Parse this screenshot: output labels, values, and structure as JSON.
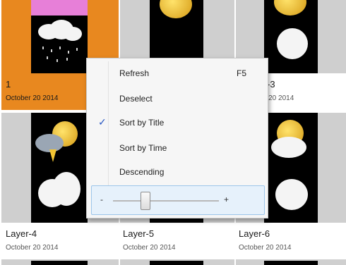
{
  "tiles": [
    {
      "title": "1",
      "date": "October 20 2014",
      "selected": true
    },
    {
      "title": "",
      "date": "",
      "selected": false
    },
    {
      "title": "-3",
      "date": "r 20 2014",
      "selected": false
    },
    {
      "title": "Layer-4",
      "date": "October 20 2014",
      "selected": false
    },
    {
      "title": "Layer-5",
      "date": "October 20 2014",
      "selected": false
    },
    {
      "title": "Layer-6",
      "date": "October 20 2014",
      "selected": false
    }
  ],
  "context_menu": {
    "items": [
      {
        "label": "Refresh",
        "shortcut": "F5",
        "checked": false
      },
      {
        "label": "Deselect",
        "shortcut": "",
        "checked": false
      },
      {
        "label": "Sort by Title",
        "shortcut": "",
        "checked": true
      },
      {
        "label": "Sort by Time",
        "shortcut": "",
        "checked": false
      },
      {
        "label": "Descending",
        "shortcut": "",
        "checked": false
      }
    ],
    "check_glyph": "✓",
    "slider": {
      "minus": "-",
      "plus": "+",
      "value": 0.3
    }
  },
  "colors": {
    "selection": "#e8881f",
    "menu_background": "#f6f6f6",
    "slider_highlight": "#e6f1fb"
  }
}
